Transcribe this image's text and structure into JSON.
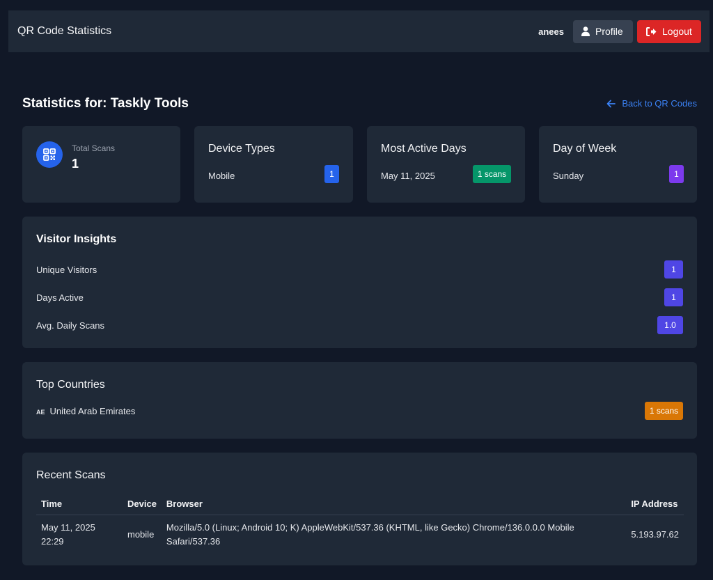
{
  "navbar": {
    "brand": "QR Code Statistics",
    "username": "anees",
    "profile_label": "Profile",
    "logout_label": "Logout"
  },
  "header": {
    "title": "Statistics for: Taskly Tools",
    "back_link": "Back to QR Codes"
  },
  "total_scans": {
    "label": "Total Scans",
    "value": "1"
  },
  "device_types": {
    "title": "Device Types",
    "items": [
      {
        "label": "Mobile",
        "count": "1"
      }
    ]
  },
  "most_active_days": {
    "title": "Most Active Days",
    "items": [
      {
        "label": "May 11, 2025",
        "count": "1 scans"
      }
    ]
  },
  "day_of_week": {
    "title": "Day of Week",
    "items": [
      {
        "label": "Sunday",
        "count": "1"
      }
    ]
  },
  "visitor_insights": {
    "title": "Visitor Insights",
    "items": [
      {
        "label": "Unique Visitors",
        "value": "1"
      },
      {
        "label": "Days Active",
        "value": "1"
      },
      {
        "label": "Avg. Daily Scans",
        "value": "1.0"
      }
    ]
  },
  "top_countries": {
    "title": "Top Countries",
    "items": [
      {
        "code": "AE",
        "name": "United Arab Emirates",
        "count": "1 scans"
      }
    ]
  },
  "recent_scans": {
    "title": "Recent Scans",
    "columns": [
      "Time",
      "Device",
      "Browser",
      "IP Address"
    ],
    "rows": [
      {
        "time_date": "May 11, 2025",
        "time_clock": "22:29",
        "device": "mobile",
        "browser": "Mozilla/5.0 (Linux; Android 10; K) AppleWebKit/537.36 (KHTML, like Gecko) Chrome/136.0.0.0 Mobile Safari/537.36",
        "ip": "5.193.97.62"
      }
    ]
  },
  "colors": {
    "background": "#111827",
    "card": "#1f2937",
    "accent_blue": "#2563eb",
    "success_green": "#059669",
    "purple": "#7c3aed",
    "indigo": "#4f46e5",
    "orange": "#d97706",
    "danger_red": "#dc2626"
  },
  "icons": {
    "profile": "user-icon",
    "logout": "sign-out-icon",
    "back": "arrow-left-icon",
    "total_scans": "qrcode-icon"
  }
}
